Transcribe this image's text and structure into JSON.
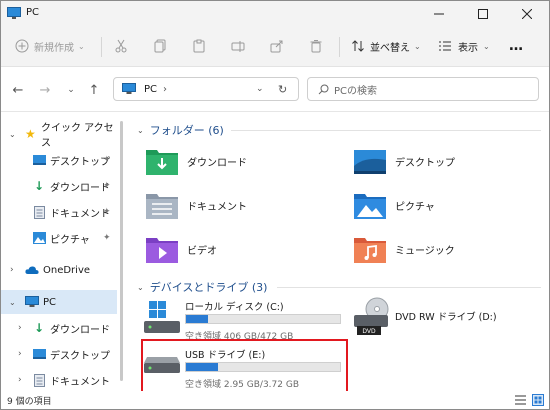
{
  "window": {
    "title": "PC"
  },
  "toolbar": {
    "new_label": "新規作成",
    "sort_label": "並べ替え",
    "view_label": "表示",
    "more_label": "…"
  },
  "address": {
    "path": "PC",
    "search_placeholder": "PCの検索"
  },
  "sidebar": {
    "items": [
      {
        "label": "クイック アクセス"
      },
      {
        "label": "デスクトップ"
      },
      {
        "label": "ダウンロード"
      },
      {
        "label": "ドキュメント"
      },
      {
        "label": "ピクチャ"
      },
      {
        "label": "OneDrive"
      },
      {
        "label": "PC"
      },
      {
        "label": "ダウンロード"
      },
      {
        "label": "デスクトップ"
      },
      {
        "label": "ドキュメント"
      }
    ]
  },
  "folders": {
    "header": "フォルダー (6)",
    "items": [
      {
        "label": "ダウンロード",
        "icon": "downloads-folder-icon"
      },
      {
        "label": "デスクトップ",
        "icon": "desktop-folder-icon"
      },
      {
        "label": "ドキュメント",
        "icon": "documents-folder-icon"
      },
      {
        "label": "ピクチャ",
        "icon": "pictures-folder-icon"
      },
      {
        "label": "ビデオ",
        "icon": "videos-folder-icon"
      },
      {
        "label": "ミュージック",
        "icon": "music-folder-icon"
      }
    ]
  },
  "drives": {
    "header": "デバイスとドライブ (3)",
    "items": [
      {
        "name": "ローカル ディスク (C:)",
        "free": "空き領域 406 GB/472 GB",
        "used_fraction": 0.14
      },
      {
        "name": "DVD RW ドライブ (D:)",
        "free": "",
        "used_fraction": null
      },
      {
        "name": "USB ドライブ (E:)",
        "free": "空き領域 2.95 GB/3.72 GB",
        "used_fraction": 0.21
      }
    ]
  },
  "status": {
    "count": "9 個の項目"
  },
  "colors": {
    "accent": "#2a7bd3",
    "highlight": "#e2181f",
    "selection": "#d9e8f7"
  }
}
